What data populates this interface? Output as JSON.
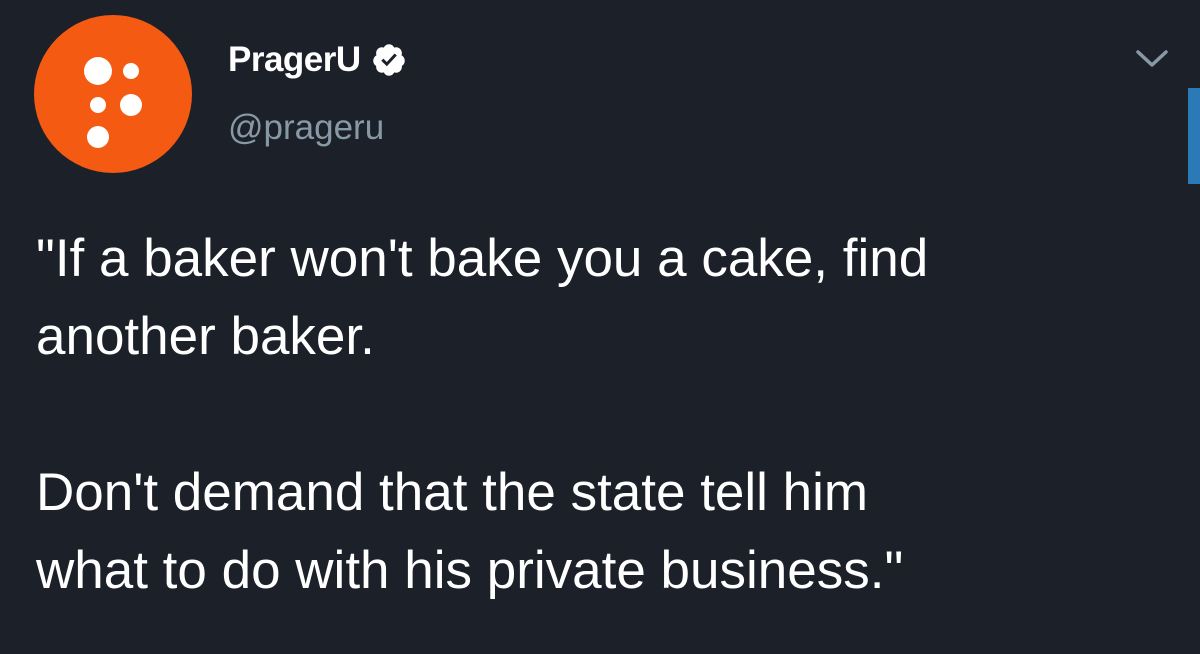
{
  "tweet": {
    "display_name": "PragerU",
    "handle": "@prageru",
    "verified": true,
    "text_lines": [
      "\"If a baker won't bake you a cake, find",
      "another baker.",
      "Don't demand that the state tell him",
      "what to do with his private business.\""
    ]
  },
  "icons": {
    "avatar": "prageru-logo",
    "verified": "verified-badge-icon",
    "menu": "chevron-down-icon"
  },
  "colors": {
    "background": "#1b2029",
    "avatar": "#f45a12",
    "text": "#ffffff",
    "handle": "#8899a6",
    "scrollbar": "#2a7ab8"
  }
}
